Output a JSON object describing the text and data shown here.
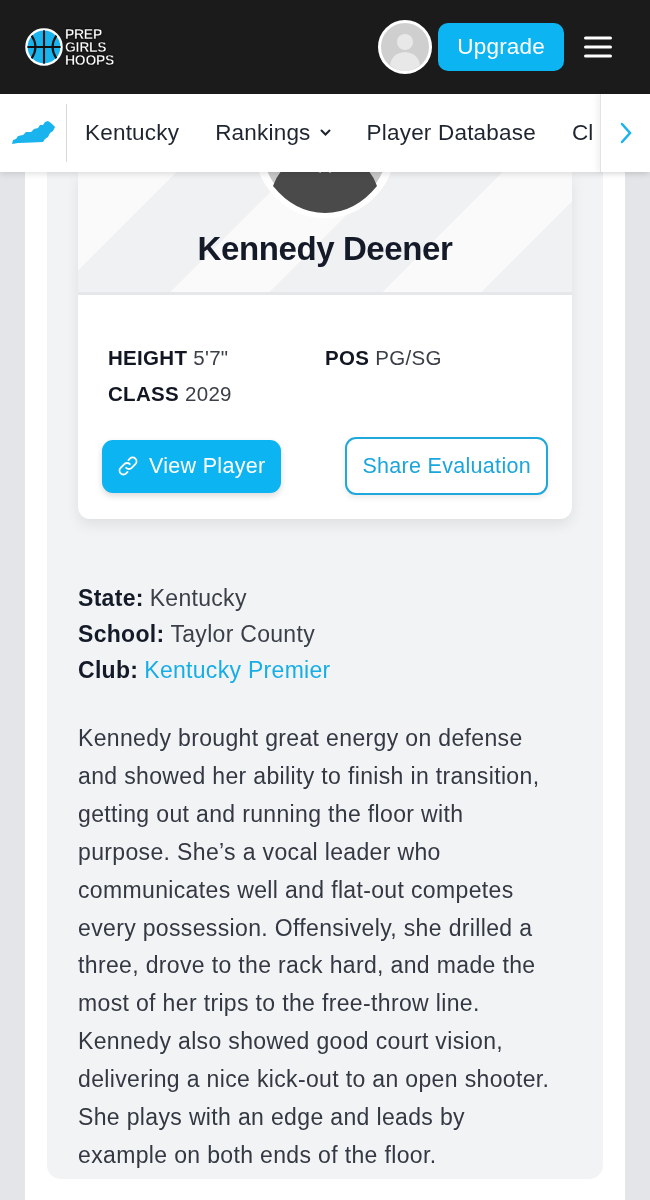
{
  "header": {
    "logo_text": "PREP GIRLS HOOPS",
    "upgrade_button": "Upgrade"
  },
  "nav": {
    "items": [
      {
        "label": "Kentucky",
        "kind": "link"
      },
      {
        "label": "Rankings",
        "kind": "dropdown"
      },
      {
        "label": "Player Database",
        "kind": "link"
      },
      {
        "label": "Cl",
        "kind": "link"
      }
    ]
  },
  "player": {
    "name": "Kennedy Deener",
    "stats": [
      {
        "label": "HEIGHT",
        "value": "5'7\""
      },
      {
        "label": "POS",
        "value": "PG/SG"
      },
      {
        "label": "CLASS",
        "value": "2029"
      }
    ],
    "buttons": [
      {
        "label": "View Player",
        "kind": "primary"
      },
      {
        "label": "Share Evaluation",
        "kind": "outline"
      }
    ]
  },
  "details": [
    {
      "label": "State:",
      "value": "Kentucky",
      "kind": "text"
    },
    {
      "label": "School:",
      "value": "Taylor County",
      "kind": "text"
    },
    {
      "label": "Club:",
      "value": "Kentucky Premier",
      "kind": "link"
    }
  ],
  "evaluation": "Kennedy brought great energy on defense and showed her ability to finish in transition, getting out and running the floor with purpose. She’s a vocal leader who communicates well and flat-out competes every possession. Offensively, she drilled a three, drove to the rack hard, and made the most of her trips to the free-throw line. Kennedy also showed good court vision, delivering a nice kick-out to an open shooter. She plays with an edge and leads by example on both ends of the floor."
}
